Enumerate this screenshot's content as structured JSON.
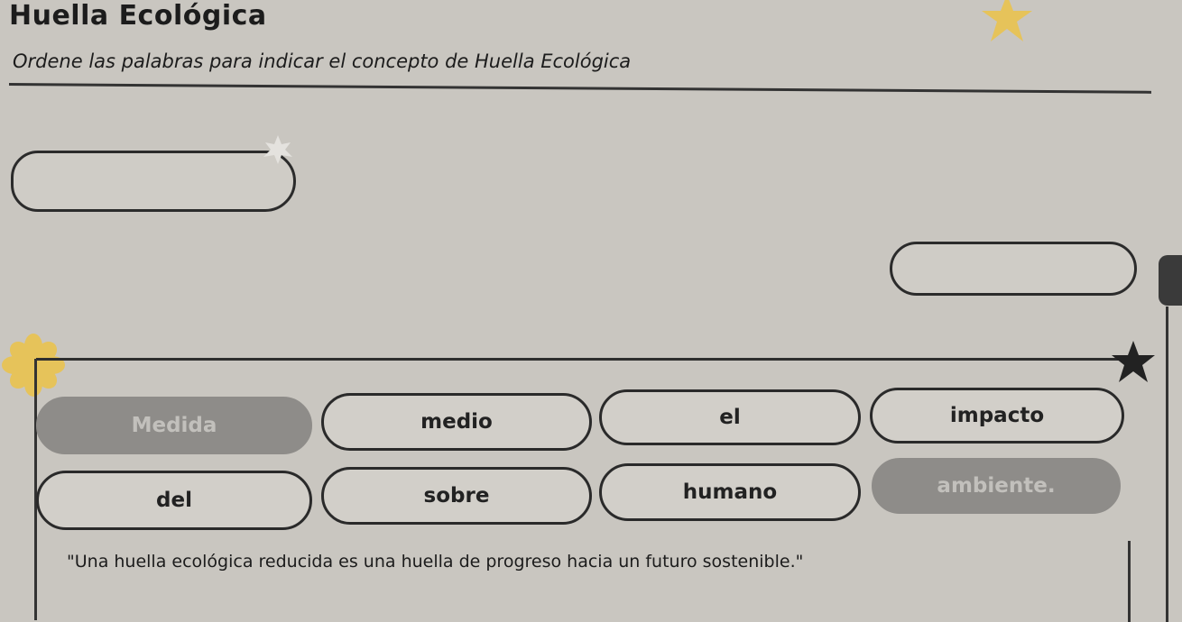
{
  "header": {
    "title": "Huella Ecológica",
    "instruction": "Ordene las palabras para indicar el concepto de Huella Ecológica"
  },
  "answer_slots": [
    "",
    ""
  ],
  "word_bank": [
    {
      "label": "Medida",
      "used": true
    },
    {
      "label": "medio",
      "used": false
    },
    {
      "label": "el",
      "used": false
    },
    {
      "label": "impacto",
      "used": false
    },
    {
      "label": "del",
      "used": false
    },
    {
      "label": "sobre",
      "used": false
    },
    {
      "label": "humano",
      "used": false
    },
    {
      "label": "ambiente.",
      "used": true
    }
  ],
  "quote": "\"Una huella ecológica reducida es una huella de progreso hacia un futuro sostenible.\"",
  "colors": {
    "background": "#c9c6c0",
    "star_gold": "#e6c35a",
    "used_word": "#8e8c89"
  },
  "icons": [
    "star-icon",
    "flower-icon",
    "star-dark-icon",
    "puzzle-notch-icon"
  ]
}
